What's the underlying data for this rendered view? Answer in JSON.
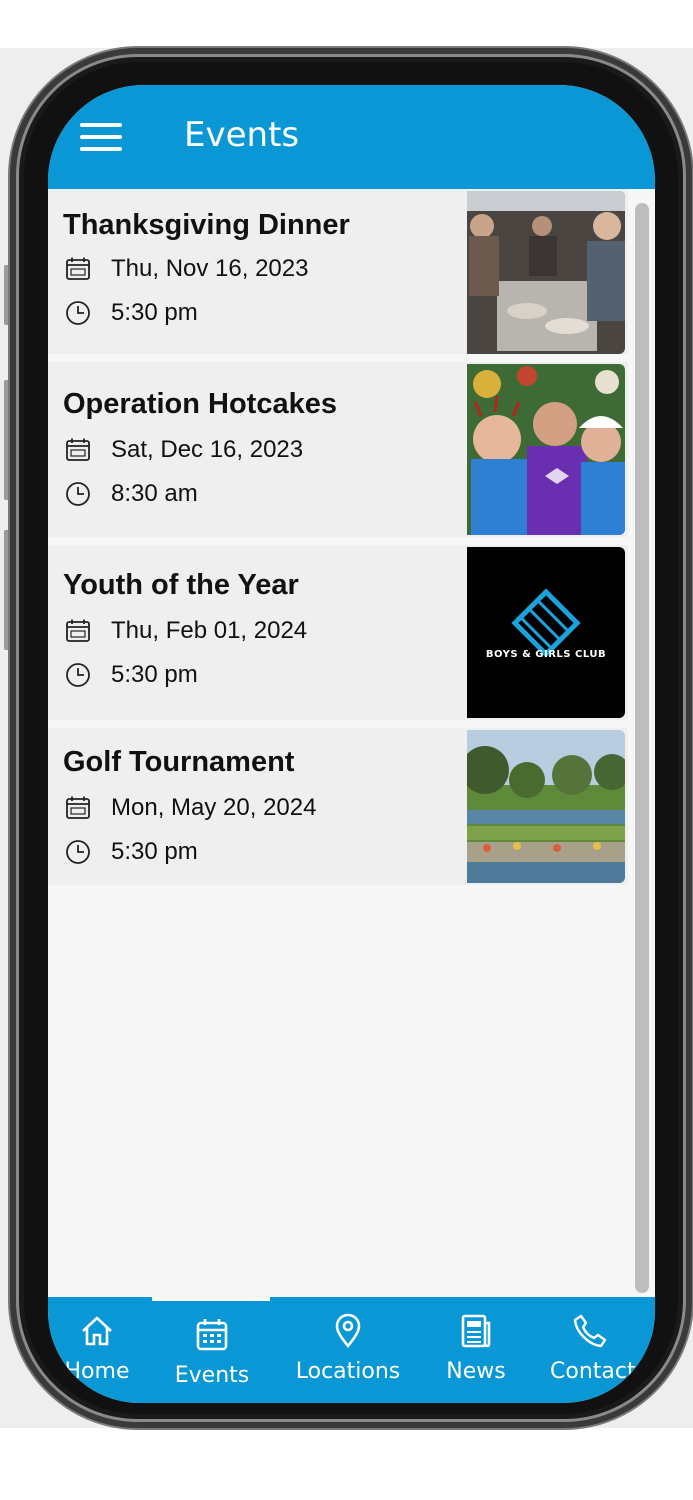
{
  "app": {
    "title": "Events"
  },
  "events": [
    {
      "title": "Thanksgiving Dinner",
      "date": "Thu, Nov 16, 2023",
      "time": "5:30 pm",
      "image": "thanksgiving-photo"
    },
    {
      "title": "Operation Hotcakes",
      "date": "Sat, Dec 16, 2023",
      "time": "8:30 am",
      "image": "kids-christmas-photo"
    },
    {
      "title": "Youth of the Year",
      "date": "Thu, Feb 01, 2024",
      "time": "5:30 pm",
      "image": "club-logo"
    },
    {
      "title": "Golf Tournament",
      "date": "Mon, May 20, 2024",
      "time": "5:30 pm",
      "image": "golf-course-photo"
    }
  ],
  "logo_text": "BOYS & GIRLS CLUB",
  "nav": [
    {
      "label": "Home",
      "icon": "home-icon"
    },
    {
      "label": "Events",
      "icon": "calendar-icon",
      "active": true
    },
    {
      "label": "Locations",
      "icon": "location-pin-icon"
    },
    {
      "label": "News",
      "icon": "news-icon"
    },
    {
      "label": "Contact",
      "icon": "phone-icon"
    }
  ],
  "colors": {
    "primary": "#0a97d6",
    "card_bg": "#efefef",
    "page_bg": "#f7f7f7"
  }
}
